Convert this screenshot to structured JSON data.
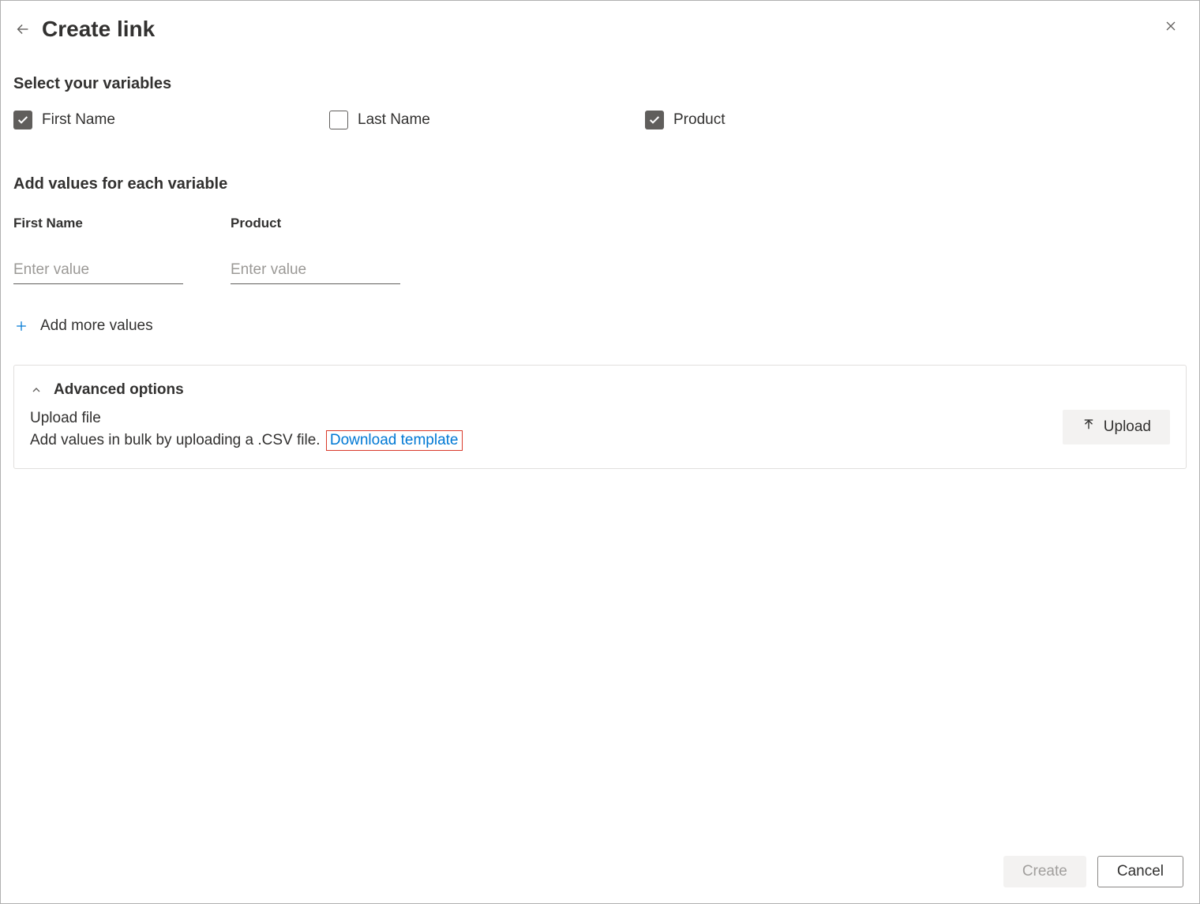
{
  "header": {
    "title": "Create link"
  },
  "variables_section": {
    "title": "Select your variables",
    "items": [
      {
        "label": "First Name",
        "checked": true
      },
      {
        "label": "Last Name",
        "checked": false
      },
      {
        "label": "Product",
        "checked": true
      }
    ]
  },
  "values_section": {
    "title": "Add values for each variable",
    "columns": [
      {
        "header": "First Name",
        "placeholder": "Enter value"
      },
      {
        "header": "Product",
        "placeholder": "Enter value"
      }
    ],
    "add_more_label": "Add more values"
  },
  "advanced": {
    "title": "Advanced options",
    "upload_title": "Upload file",
    "upload_desc": "Add values in bulk by uploading a .CSV file.",
    "download_template_label": "Download template",
    "upload_button_label": "Upload"
  },
  "footer": {
    "create_label": "Create",
    "cancel_label": "Cancel"
  }
}
